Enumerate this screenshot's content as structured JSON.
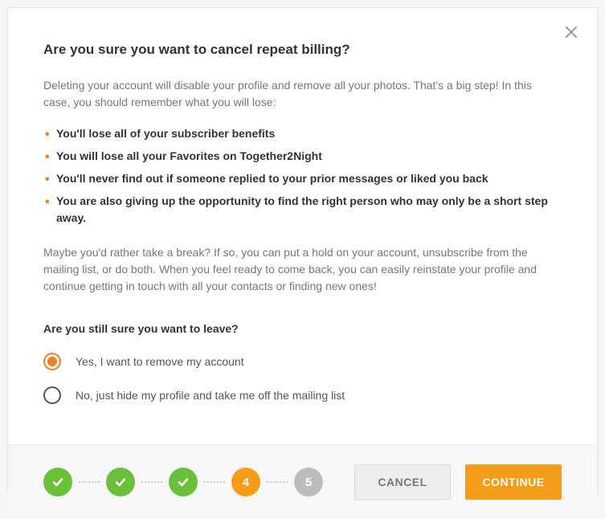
{
  "title": "Are you sure you want to cancel repeat billing?",
  "intro": "Deleting your account will disable your profile and remove all your photos. That's a big step! In this case, you should remember what you will lose:",
  "bullets": [
    "You'll lose all of your subscriber benefits",
    "You will lose all your Favorites on Together2Night",
    "You'll never find out if someone replied to your prior messages or liked you back",
    "You are also giving up the opportunity to find the right person who may only be a short step away."
  ],
  "outro": "Maybe you'd rather take a break? If so, you can put a hold on your account, unsubscribe from the mailing list, or do both. When you feel ready to come back, you can easily reinstate your profile and continue getting in touch with all your contacts or finding new ones!",
  "prompt": "Are you still sure you want to leave?",
  "options": {
    "yes": "Yes, I want to remove my account",
    "no": "No, just hide my profile and take me off the mailing list",
    "selected": "yes"
  },
  "stepper": {
    "steps": [
      {
        "state": "done"
      },
      {
        "state": "done"
      },
      {
        "state": "done"
      },
      {
        "state": "current",
        "label": "4"
      },
      {
        "state": "pending",
        "label": "5"
      }
    ]
  },
  "buttons": {
    "cancel": "CANCEL",
    "continue": "CONTINUE"
  }
}
